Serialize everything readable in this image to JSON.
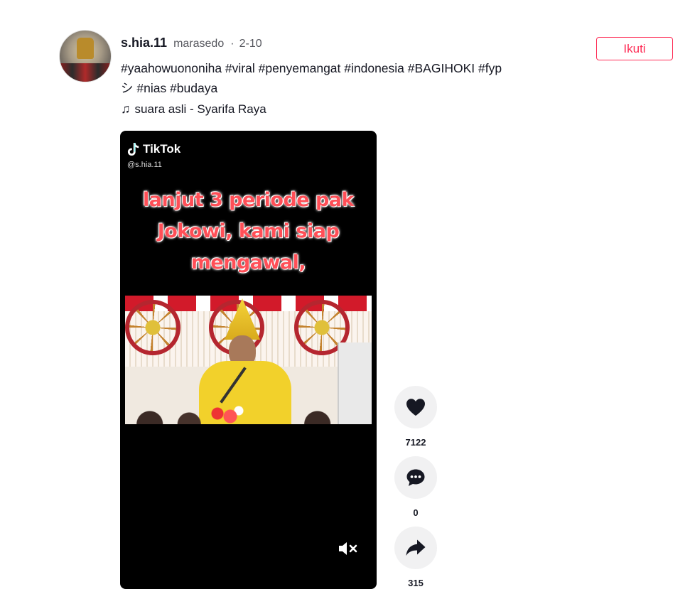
{
  "post": {
    "username": "s.hia.11",
    "nickname": "marasedo",
    "date": "2-10",
    "caption_line1": "#yaahowuononiha #viral #penyemangat #indonesia #BAGIHOKI #fyp",
    "caption_line2": "シ #nias #budaya",
    "music": "suara asli - Syarifa Raya",
    "follow_label": "Ikuti"
  },
  "video": {
    "watermark": "TikTok",
    "handle": "@s.hia.11",
    "overlay_lines": [
      "lanjut 3 periode pak",
      "Jokowi, kami siap",
      "mengawal,"
    ]
  },
  "actions": {
    "likes": "7122",
    "comments": "0",
    "shares": "315"
  },
  "colors": {
    "accent": "#fe2c55",
    "overlay_text": "#ff4f57",
    "action_bg": "#f1f1f2"
  },
  "icons": [
    "heart-icon",
    "comment-icon",
    "share-icon",
    "music-note-icon",
    "mute-icon",
    "tiktok-logo-icon"
  ]
}
